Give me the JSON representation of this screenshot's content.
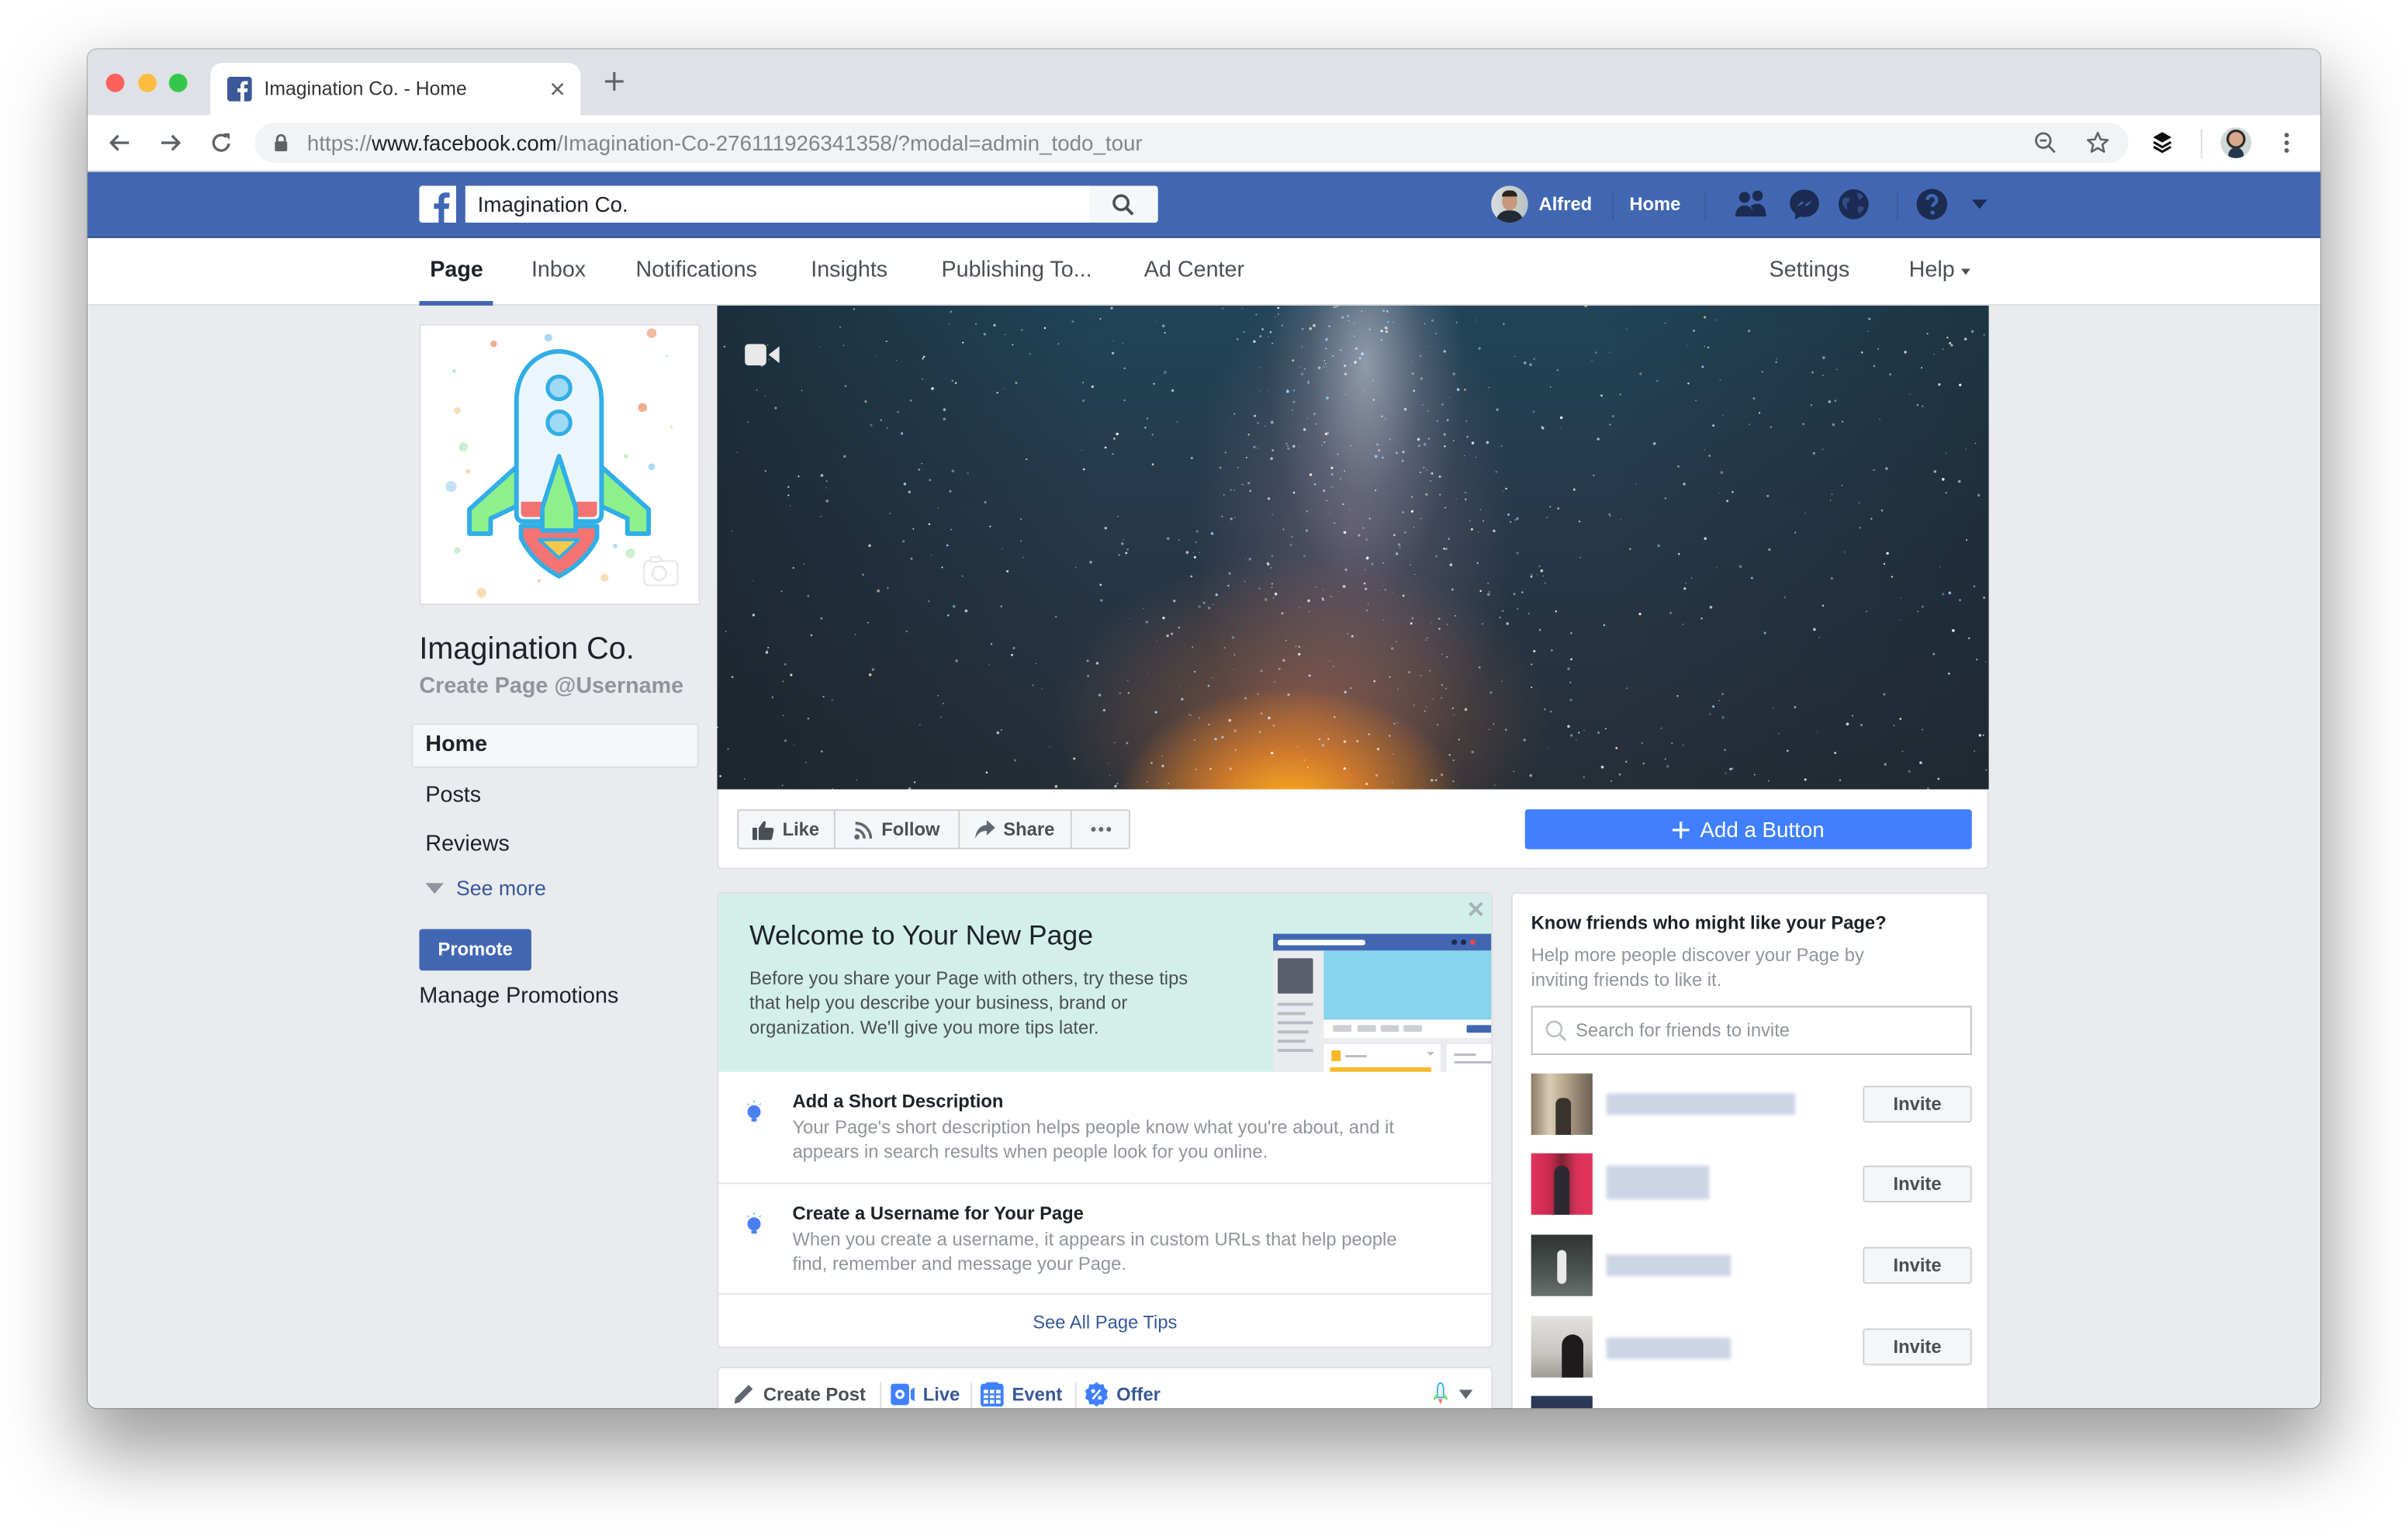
{
  "colors": {
    "fb_blue": "#4267b2",
    "accent": "#4080ff",
    "link": "#385898",
    "mint": "#d3f0e8",
    "page_bg": "#e9ebee"
  },
  "browser": {
    "tab": {
      "title": "Imagination Co. - Home",
      "favicon": "facebook-icon"
    },
    "url": {
      "scheme": "https://",
      "host": "www.facebook.com",
      "path": "/Imagination-Co-276111926341358/?modal=admin_todo_tour"
    },
    "toolbar_icons": [
      "back-icon",
      "forward-icon",
      "reload-icon",
      "lock-icon",
      "zoom-out-icon",
      "bookmark-star-icon",
      "buffer-layers-icon",
      "profile-avatar",
      "menu-kebab-icon"
    ]
  },
  "fb_header": {
    "search_value": "Imagination Co.",
    "user_name": "Alfred",
    "home_label": "Home",
    "icons": [
      "friend-requests-icon",
      "messenger-icon",
      "notifications-globe-icon",
      "help-icon",
      "account-caret-icon"
    ]
  },
  "page_nav": {
    "tabs": [
      {
        "label": "Page",
        "active": true
      },
      {
        "label": "Inbox"
      },
      {
        "label": "Notifications"
      },
      {
        "label": "Insights"
      },
      {
        "label": "Publishing To..."
      },
      {
        "label": "Ad Center"
      }
    ],
    "settings": "Settings",
    "help": "Help"
  },
  "sidebar": {
    "page_name": "Imagination Co.",
    "username_link": "Create Page @Username",
    "items": [
      {
        "label": "Home",
        "active": true
      },
      {
        "label": "Posts"
      },
      {
        "label": "Reviews"
      }
    ],
    "see_more": "See more",
    "promote": "Promote",
    "manage_promotions": "Manage Promotions"
  },
  "actions": {
    "like": "Like",
    "follow": "Follow",
    "share": "Share",
    "add_button": "Add a Button"
  },
  "welcome": {
    "title": "Welcome to Your New Page",
    "description_lines": [
      "Before you share your Page with others, try these tips",
      "that help you describe your business, brand or",
      "organization. We'll give you more tips later."
    ],
    "tips": [
      {
        "title": "Add a Short Description",
        "body_lines": [
          "Your Page's short description helps people know what you're about, and it",
          "appears in search results when people look for you online."
        ]
      },
      {
        "title": "Create a Username for Your Page",
        "body_lines": [
          "When you create a username, it appears in custom URLs that help people",
          "find, remember and message your Page."
        ]
      }
    ],
    "see_all": "See All Page Tips"
  },
  "composer": {
    "items": [
      {
        "label": "Create Post",
        "icon": "pencil-icon"
      },
      {
        "label": "Live",
        "icon": "live-video-icon"
      },
      {
        "label": "Event",
        "icon": "calendar-icon"
      },
      {
        "label": "Offer",
        "icon": "offer-badge-icon"
      }
    ]
  },
  "invite": {
    "title": "Know friends who might like your Page?",
    "description_lines": [
      "Help more people discover your Page by",
      "inviting friends to like it."
    ],
    "search_placeholder": "Search for friends to invite",
    "invite_label": "Invite",
    "friend_names_redacted": true
  }
}
